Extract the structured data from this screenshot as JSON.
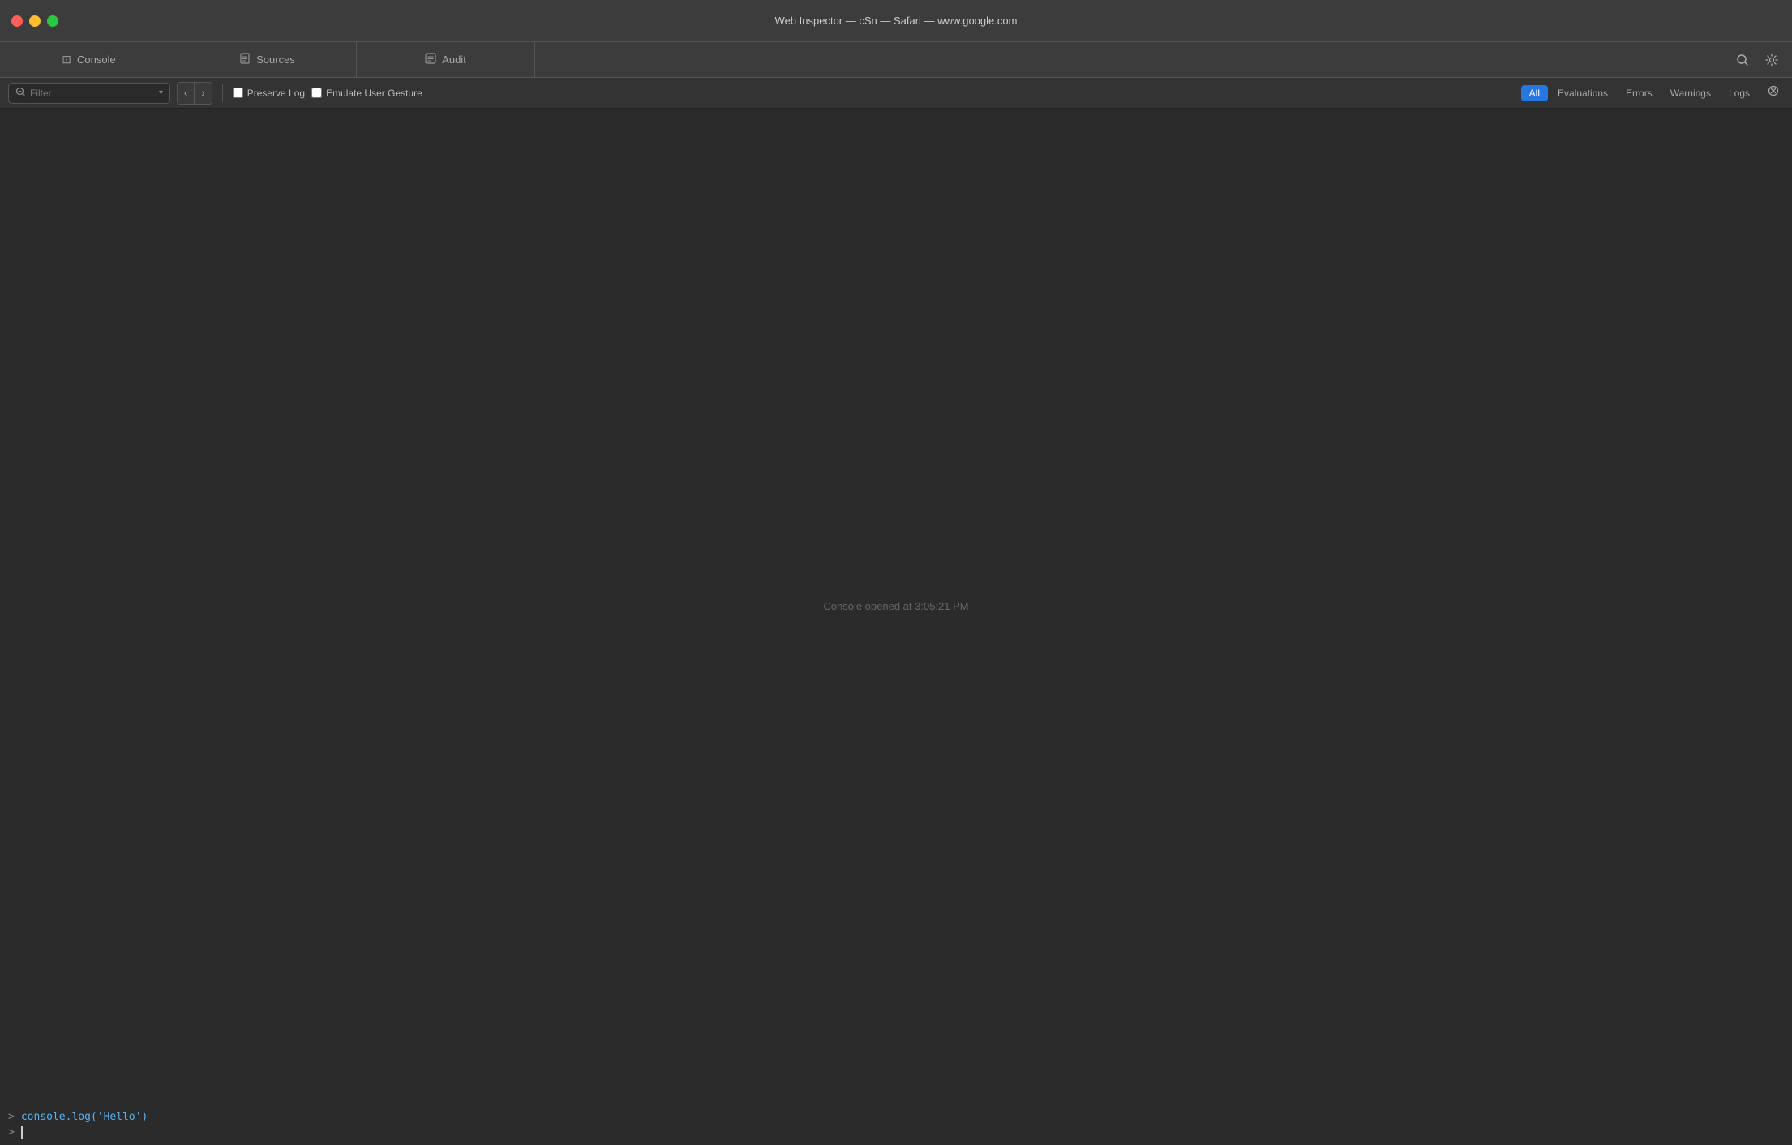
{
  "window": {
    "title": "Web Inspector — cSn — Safari — www.google.com"
  },
  "traffic_lights": {
    "close": "close",
    "minimize": "minimize",
    "maximize": "maximize"
  },
  "tabs": [
    {
      "id": "console",
      "label": "Console",
      "icon": "⊡",
      "active": false
    },
    {
      "id": "sources",
      "label": "Sources",
      "icon": "📄",
      "active": false
    },
    {
      "id": "audit",
      "label": "Audit",
      "icon": "⊡",
      "active": false
    }
  ],
  "toolbar": {
    "search_placeholder": "Filter",
    "preserve_log_label": "Preserve Log",
    "emulate_user_gesture_label": "Emulate User Gesture",
    "filter_tabs": [
      {
        "id": "all",
        "label": "All",
        "active": true
      },
      {
        "id": "evaluations",
        "label": "Evaluations",
        "active": false
      },
      {
        "id": "errors",
        "label": "Errors",
        "active": false
      },
      {
        "id": "warnings",
        "label": "Warnings",
        "active": false
      },
      {
        "id": "logs",
        "label": "Logs",
        "active": false
      }
    ]
  },
  "console": {
    "opened_text": "Console opened at 3:05:21 PM",
    "history": [
      {
        "prompt": ">",
        "code": "console.log('Hello')"
      }
    ],
    "current_prompt": ">"
  },
  "icons": {
    "search": "⌕",
    "prev": "‹",
    "next": "›",
    "search_main": "🔍",
    "settings": "⚙"
  }
}
